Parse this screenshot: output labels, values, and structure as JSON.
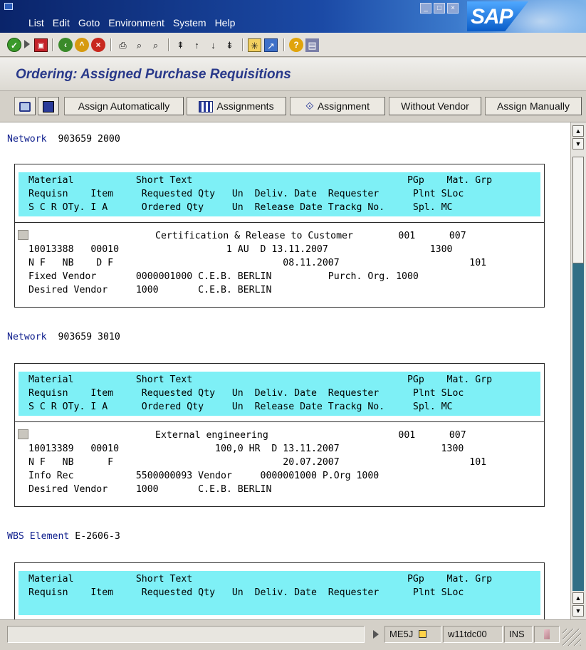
{
  "menu": {
    "items": [
      "List",
      "Edit",
      "Goto",
      "Environment",
      "System",
      "Help"
    ]
  },
  "brand": {
    "logo_text": "SAP"
  },
  "toolbar": {
    "icons": [
      "check-icon",
      "command-field-icon",
      "save-icon",
      "back-icon",
      "exit-icon",
      "cancel-icon",
      "print-icon",
      "find-icon",
      "find-next-icon",
      "first-page-icon",
      "previous-page-icon",
      "next-page-icon",
      "last-page-icon",
      "create-session-icon",
      "shortcut-icon",
      "help-icon",
      "layout-menu-icon"
    ]
  },
  "title": {
    "text": "Ordering: Assigned Purchase Requisitions"
  },
  "app_toolbar": {
    "buttons": [
      {
        "label": "",
        "icon": "select-icon"
      },
      {
        "label": "",
        "icon": "detail-icon"
      },
      {
        "label": "Assign Automatically",
        "icon": ""
      },
      {
        "label": "Assignments",
        "icon": "table-icon"
      },
      {
        "label": "Assignment",
        "icon": "assign-icon"
      },
      {
        "label": "Without Vendor",
        "icon": ""
      },
      {
        "label": "Assign Manually",
        "icon": ""
      }
    ]
  },
  "header_rows": {
    "r1": "Material           Short Text                                      PGp    Mat. Grp",
    "r2": "Requisn    Item     Requested Qty   Un  Deliv. Date  Requester      Plnt SLoc",
    "r3": "S C R OTy. I A      Ordered Qty     Un  Release Date Trackg No.     Spl. MC"
  },
  "sections": [
    {
      "label": "Network",
      "value": "903659 2000",
      "rows": [
        "Certification & Release to Customer        001      007",
        "10013388   00010                   1 AU  D 13.11.2007                  1300",
        "N F   NB    D F                              08.11.2007                       101",
        "Fixed Vendor       0000001000 C.E.B. BERLIN          Purch. Org. 1000",
        "Desired Vendor     1000       C.E.B. BERLIN"
      ]
    },
    {
      "label": "Network",
      "value": "903659 3010",
      "rows": [
        "External engineering                       001      007",
        "10013389   00010                 100,0 HR  D 13.11.2007                  1300",
        "N F   NB      F                              20.07.2007                       101",
        "Info Rec           5500000093 Vendor     0000001000 P.Org 1000",
        "Desired Vendor     1000       C.E.B. BERLIN"
      ]
    },
    {
      "label": "WBS Element",
      "value": "E-2606-3"
    }
  ],
  "status_bar": {
    "transaction": "ME5J",
    "server": "w11tdc00",
    "mode": "INS"
  },
  "colors": {
    "header_band": "#7ef0f6",
    "title_text": "#29398a",
    "network_label": "#10208e"
  }
}
